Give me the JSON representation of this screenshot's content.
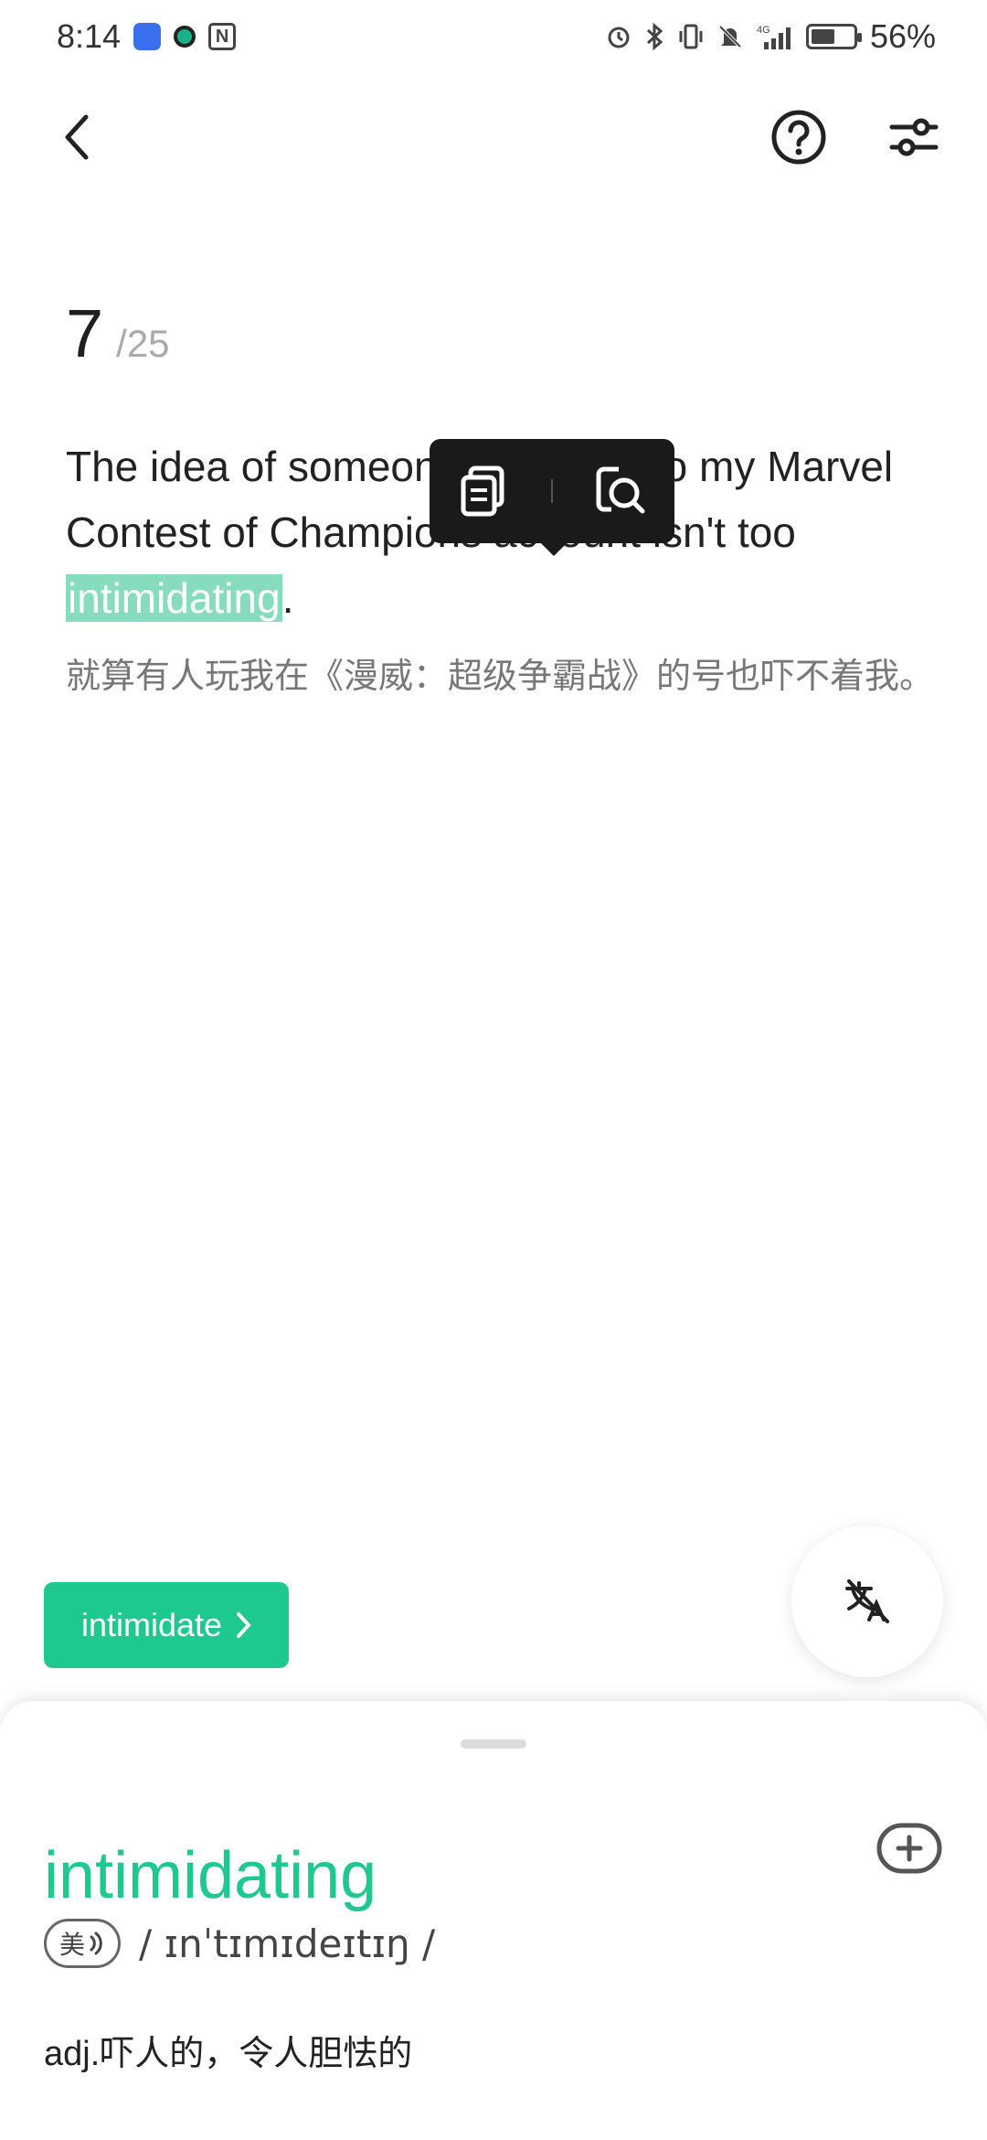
{
  "status_bar": {
    "time": "8:14",
    "battery_percent": "56%",
    "battery_level": 0.56,
    "icons": [
      "app-blue-icon",
      "app-green-icon",
      "nfc-icon",
      "alarm-icon",
      "bluetooth-icon",
      "vibrate-icon",
      "mute-icon",
      "signal-4g-icon",
      "battery-icon"
    ]
  },
  "toolbar": {
    "back_icon": "chevron-left-icon",
    "help_icon": "question-circle-icon",
    "settings_icon": "sliders-icon"
  },
  "progress": {
    "current": "7",
    "total": "/25"
  },
  "sentence": {
    "before": "The idea of someone logging into my Marvel Contest of Champions account isn't too ",
    "highlight": "intimidating",
    "after": ".",
    "translation": "就算有人玩我在《漫威：超级争霸战》的号也吓不着我。"
  },
  "selection_popup": {
    "copy_icon": "copy-icon",
    "lookup_icon": "search-document-icon"
  },
  "lemma_chip": {
    "label": "intimidate"
  },
  "fab": {
    "icon": "translation-off-icon"
  },
  "word_card": {
    "word": "intimidating",
    "accent_label": "美",
    "phonetic": "/ ɪnˈtɪmɪdeɪtɪŋ /",
    "definition": "adj.吓人的，令人胆怯的",
    "accent_color": "#1dc98e"
  },
  "colors": {
    "highlight": "#87dcbe",
    "primary": "#1dc98e",
    "popup_bg": "#1a1a1a"
  }
}
